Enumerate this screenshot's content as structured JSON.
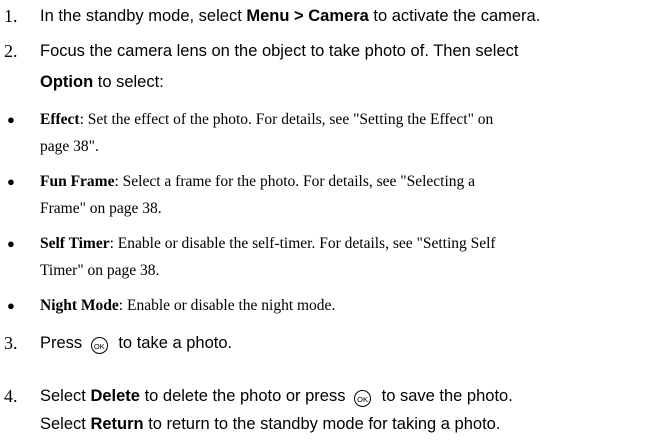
{
  "steps": [
    {
      "number": "1.",
      "pre": "In the standby mode, select ",
      "bold": "Menu > Camera",
      "post": " to activate the camera."
    },
    {
      "number": "2.",
      "line1": "Focus the camera lens on the object to take photo of. Then select",
      "bold": "Option",
      "post": " to select:"
    },
    {
      "number": "3.",
      "pre": "Press ",
      "post": " to take a photo."
    },
    {
      "number": "4.",
      "pre": "Select ",
      "bold1": "Delete",
      "mid": " to delete the photo or press ",
      "post": " to save the photo.",
      "line2_pre": "Select ",
      "bold2": "Return",
      "line2_post": " to return to the standby mode for taking a photo."
    }
  ],
  "options": [
    {
      "bullet": "●",
      "term": "Effect",
      "line1": ": Set the effect of the photo. For details, see \"Setting the Effect\" on",
      "line2": "page 38\"."
    },
    {
      "bullet": "●",
      "term": "Fun Frame",
      "line1": ": Select a frame for the photo. For details, see \"Selecting a",
      "line2": "Frame\" on page 38."
    },
    {
      "bullet": "●",
      "term": "Self Timer",
      "line1": ": Enable or disable the self-timer. For details, see \"Setting Self",
      "line2": "Timer\" on page 38."
    },
    {
      "bullet": "●",
      "term": "Night Mode",
      "line1": ": Enable or disable the night mode."
    }
  ],
  "ok_icon_label": "OK"
}
